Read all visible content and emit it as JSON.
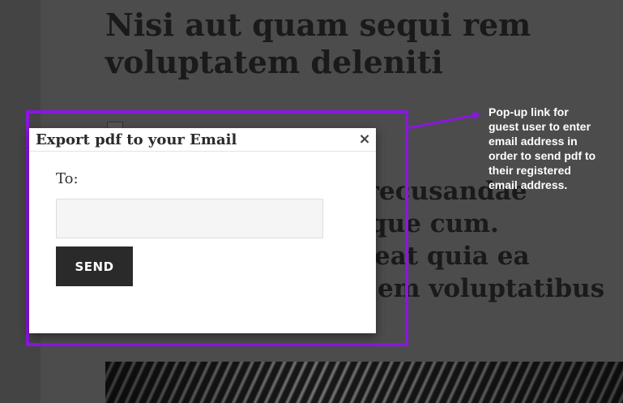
{
  "article": {
    "title_lines": [
      "Nisi aut quam sequi rem",
      "voluptatem deleniti"
    ],
    "subtitle_lines": [
      "m recusandae",
      "que cum.",
      "eat quia ea",
      "em voluptatibus"
    ]
  },
  "modal": {
    "title": "Export pdf to your Email",
    "close_glyph": "×",
    "to_label": "To:",
    "email_value": "",
    "email_placeholder": "",
    "send_label": "SEND"
  },
  "annotation": {
    "lines": [
      "Pop-up link for",
      "guest user to enter",
      "email address in",
      "order to send pdf to",
      "their registered",
      "email address."
    ],
    "color": "#ffffff"
  },
  "colors": {
    "highlight": "#8a17e0",
    "overlay": "#4c4c4c",
    "button": "#2a2a2a"
  },
  "icons": {
    "close": "close-icon",
    "arrow": "arrow-icon",
    "broken_image": "broken-image-icon"
  }
}
